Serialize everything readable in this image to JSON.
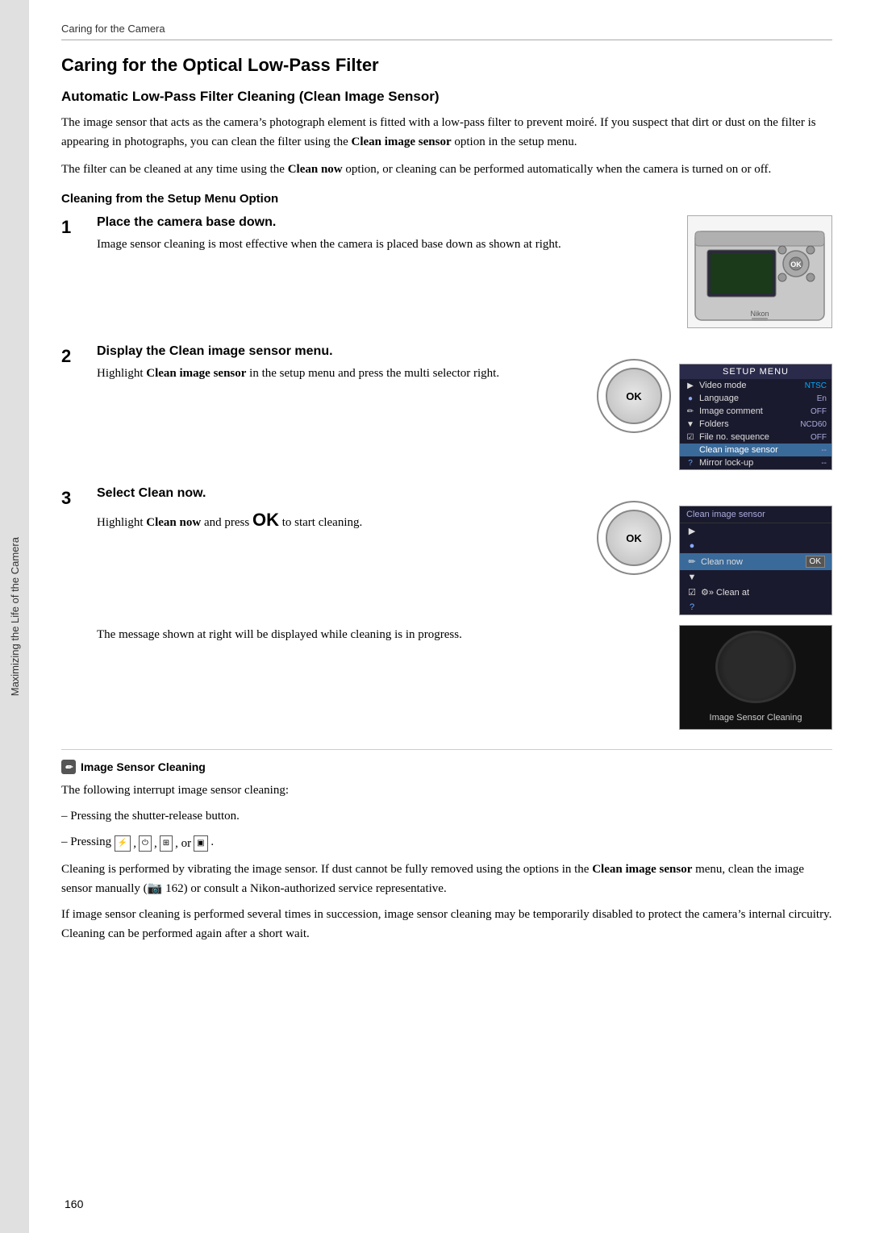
{
  "breadcrumb": "Caring for the Camera",
  "chapter_title": "Caring for the Optical Low-Pass Filter",
  "section1_title": "Automatic Low-Pass Filter Cleaning (Clean Image Sensor)",
  "para1": "The image sensor that acts as the camera’s photograph element is fitted with a low-pass filter to prevent moiré. If you suspect that dirt or dust on the filter is appearing in photographs, you can clean the filter using the ",
  "para1_bold": "Clean image sensor",
  "para1_end": " option in the setup menu.",
  "para2_start": "The filter can be cleaned at any time using the ",
  "para2_bold": "Clean now",
  "para2_end": " option, or cleaning can be performed automatically when the camera is turned on or off.",
  "subsection_title": "Cleaning from the Setup Menu Option",
  "step1_number": "1",
  "step1_title": "Place the camera base down.",
  "step1_text": "Image sensor cleaning is most effective when the camera is placed base down as shown at right.",
  "step2_number": "2",
  "step2_title_start": "Display the ",
  "step2_title_bold": "Clean image sensor",
  "step2_title_end": " menu.",
  "step2_text_start": "Highlight ",
  "step2_text_bold": "Clean image sensor",
  "step2_text_end": " in the setup menu and press the multi selector right.",
  "step3_number": "3",
  "step3_title_start": "Select ",
  "step3_title_bold": "Clean now",
  "step3_title_end": ".",
  "step3_text_start": "Highlight ",
  "step3_text_bold1": "Clean now",
  "step3_text_mid": " and press ",
  "step3_text_ok": "OK",
  "step3_text_end": " to start cleaning.",
  "step3_below": "The message shown at right will be displayed while cleaning is in progress.",
  "note_title": "Image Sensor Cleaning",
  "note_text1": "The following interrupt image sensor cleaning:",
  "note_text2": "– Pressing the shutter-release button.",
  "note_text3": "– Pressing",
  "note_text4": "Cleaning is performed by vibrating the image sensor. If dust cannot be fully removed using the options in the ",
  "note_bold1": "Clean image sensor",
  "note_text5": " menu, clean the image sensor manually (",
  "note_ref": "📷 162",
  "note_text6": ") or consult a Nikon-authorized service representative.",
  "note_text7": "If image sensor cleaning is performed several times in succession, image sensor cleaning may be temporarily disabled to protect the camera’s internal circuitry. Cleaning can be performed again after a short wait.",
  "page_number": "160",
  "side_tab_text": "Maximizing the Life of the Camera",
  "setup_menu": {
    "header": "SETUP MENU",
    "items": [
      {
        "icon": "►",
        "label": "Video mode",
        "value": "NTSC",
        "highlighted": false
      },
      {
        "icon": "•",
        "label": "Language",
        "value": "En",
        "highlighted": false
      },
      {
        "icon": "✏",
        "label": "Image comment",
        "value": "OFF",
        "highlighted": false
      },
      {
        "icon": "★",
        "label": "Folders",
        "value": "NCD60",
        "highlighted": false
      },
      {
        "icon": "☑",
        "label": "File no. sequence",
        "value": "OFF",
        "highlighted": false
      },
      {
        "icon": "",
        "label": "Clean image sensor",
        "value": "––",
        "highlighted": true
      },
      {
        "icon": "?",
        "label": "Mirror lock-up",
        "value": "––",
        "highlighted": false
      }
    ]
  },
  "clean_menu": {
    "header": "Clean image sensor",
    "items": [
      {
        "icon": "►",
        "label": "",
        "value": "",
        "highlighted": false
      },
      {
        "icon": "•",
        "label": "",
        "value": "",
        "highlighted": false
      },
      {
        "icon": "✏",
        "label": "Clean now",
        "value": "OK",
        "highlighted": true
      },
      {
        "icon": "★",
        "label": "",
        "value": "",
        "highlighted": false
      },
      {
        "icon": "☑",
        "label": "★» Clean at",
        "value": "",
        "highlighted": false
      },
      {
        "icon": "?",
        "label": "",
        "value": "",
        "highlighted": false
      }
    ]
  },
  "sensor_cleaning_label": "Image Sensor Cleaning"
}
